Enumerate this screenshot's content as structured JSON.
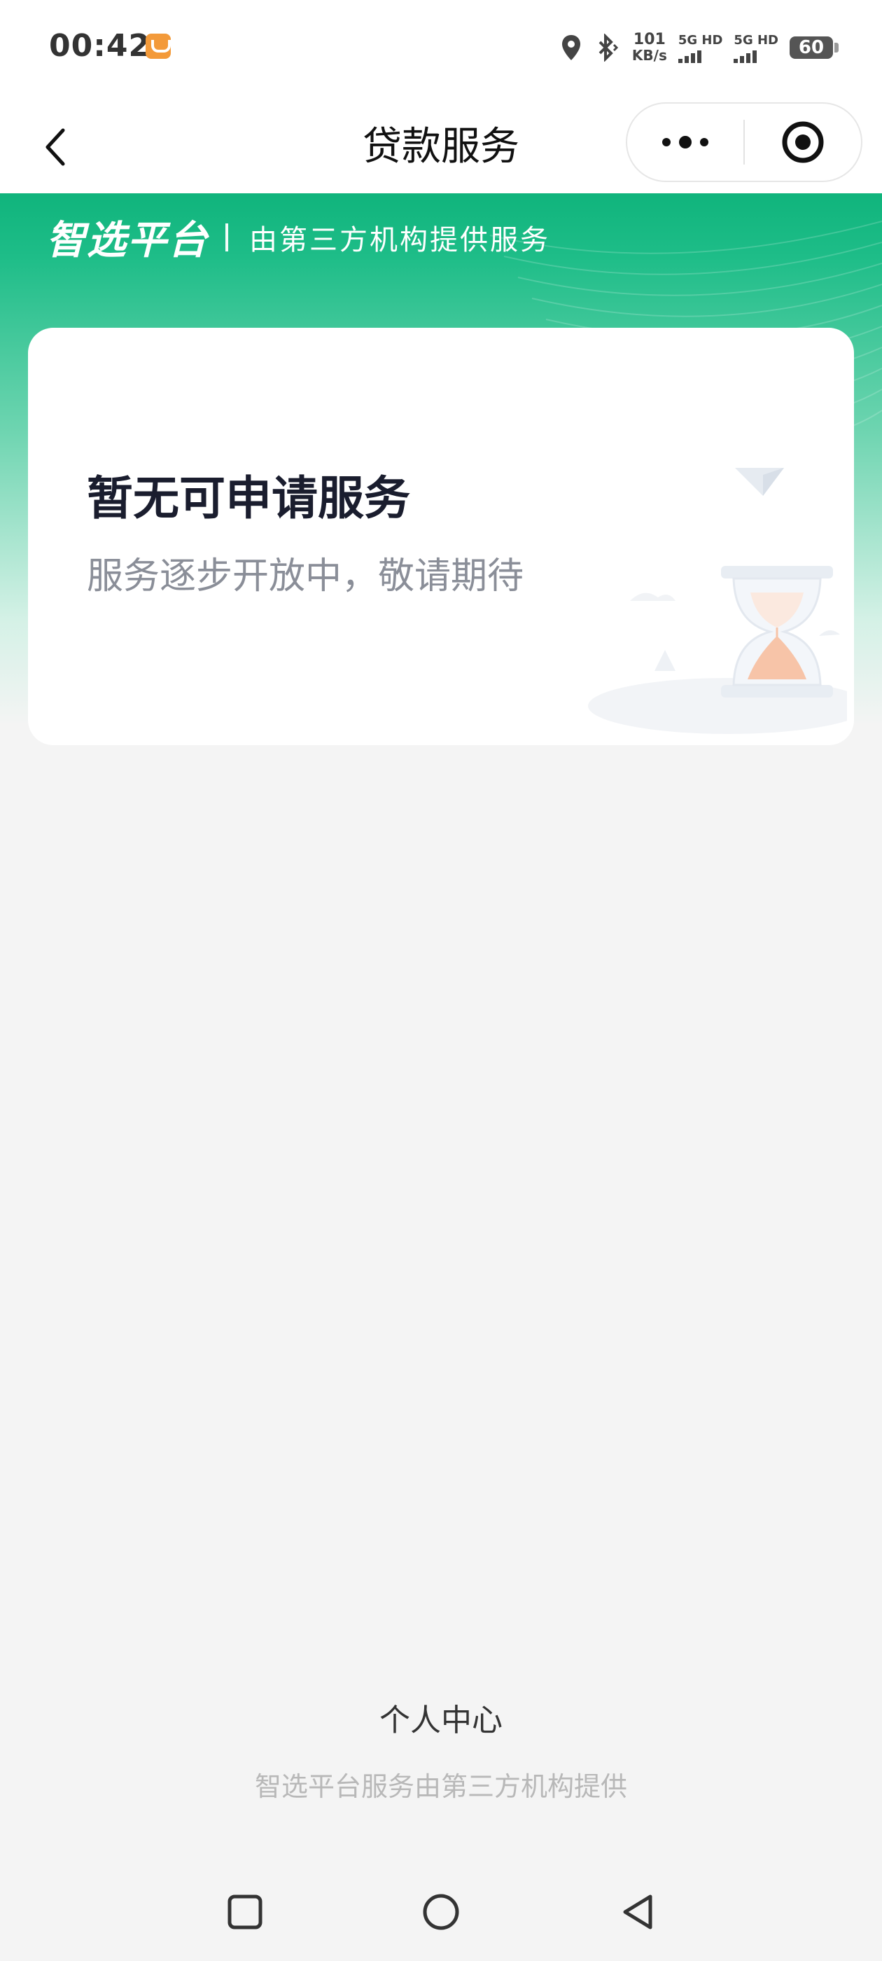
{
  "status_bar": {
    "time": "00:42",
    "speed_value": "101",
    "speed_unit": "KB/s",
    "signal1": "5G HD",
    "signal2": "5G HD",
    "battery": "60"
  },
  "navbar": {
    "title": "贷款服务"
  },
  "hero": {
    "brand": "智选平台",
    "tagline": "由第三方机构提供服务"
  },
  "card": {
    "title": "暂无可申请服务",
    "subtitle": "服务逐步开放中，敬请期待"
  },
  "footer": {
    "personal_center": "个人中心",
    "note": "智选平台服务由第三方机构提供"
  },
  "colors": {
    "brand_green": "#10b47c",
    "card_title": "#1a1d2e",
    "card_subtitle": "#8a8e98"
  }
}
